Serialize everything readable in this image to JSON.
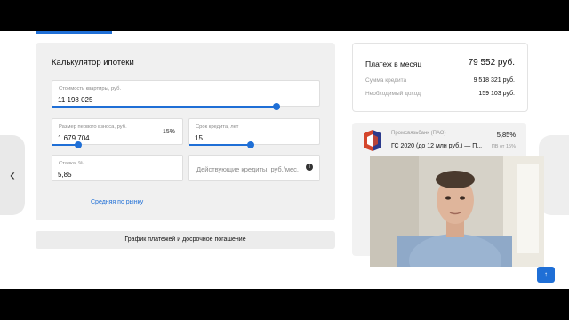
{
  "calculator": {
    "title": "Калькулятор ипотеки",
    "property_value": {
      "label": "Стоимость квартиры, руб.",
      "value": "11 198 025",
      "slider_fraction": 0.84
    },
    "down_payment": {
      "label": "Размер первого взноса, руб.",
      "value": "1 679 704",
      "percent": "15%",
      "slider_fraction": 0.2
    },
    "term": {
      "label": "Срок кредита, лет",
      "value": "15",
      "slider_fraction": 0.47
    },
    "rate": {
      "label": "Ставка, %",
      "value": "5,85"
    },
    "existing_credits": {
      "placeholder": "Действующие кредиты, руб./мес."
    },
    "market_average_link": "Средняя по рынку",
    "schedule_button": "График платежей и досрочное погашение"
  },
  "payment": {
    "title": "Платеж в месяц",
    "amount": "79 552 руб.",
    "credit_sum_label": "Сумма кредита",
    "credit_sum_value": "9 518 321 руб.",
    "income_label": "Необходимый доход",
    "income_value": "159 103 руб."
  },
  "offer": {
    "bank": "Промсвязьбанк (ПАО)",
    "rate": "5,85%",
    "product": "ГС 2020 (до 12 млн руб.) — П...",
    "psk": "ПВ от 15%"
  },
  "icons": {
    "nav_left": "chevron-left-icon",
    "info": "info-icon",
    "scroll_top": "arrow-up-icon",
    "bank_logo": "bank-logo-icon"
  },
  "colors": {
    "accent": "#1f6fd6",
    "panel": "#f0f0f0",
    "logo_red": "#d4462c",
    "logo_blue": "#2b3a8c"
  }
}
